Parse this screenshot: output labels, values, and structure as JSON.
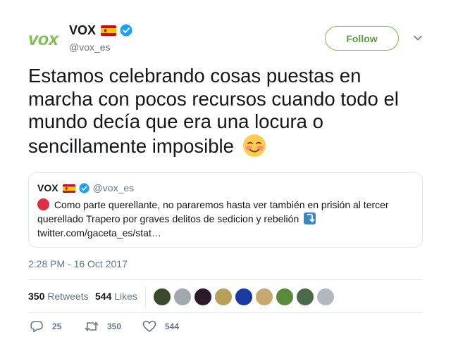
{
  "account": {
    "name": "VOX",
    "handle": "@vox_es",
    "follow_label": "Follow",
    "logo_text": "vox",
    "flag_icon": "spain-flag-icon",
    "verified_icon": "verified-badge-icon",
    "brand_color": "#7bc04a"
  },
  "tweet": {
    "text": "Estamos celebrando cosas puestas en marcha con pocos recursos cuando todo el mundo decía que era una locura o sencillamente imposible",
    "emoji": "smiling-blush-emoji",
    "timestamp": "2:28 PM - 16 Oct 2017"
  },
  "quoted_tweet": {
    "name": "VOX",
    "handle": "@vox_es",
    "text": "Como parte querellante, no pararemos hasta ver también en prisión al tercer querellado Trapero por graves delitos de sedicion y rebelión",
    "link": "twitter.com/gaceta_es/stat…",
    "leading_emoji": "red-circle-emoji",
    "trailing_emoji": "arrow-down-emoji"
  },
  "stats": {
    "retweets_count": "350",
    "retweets_label": "Retweets",
    "likes_count": "544",
    "likes_label": "Likes",
    "avatars": [
      "#3a4a2a",
      "#a0a8b0",
      "#2a1a2a",
      "#b9a05a",
      "#1a3aa0",
      "#c8a870",
      "#5a8a3a",
      "#4a6a4a",
      "#b0b8c0"
    ]
  },
  "actions": {
    "reply_count": "25",
    "retweet_count": "350",
    "like_count": "544"
  }
}
